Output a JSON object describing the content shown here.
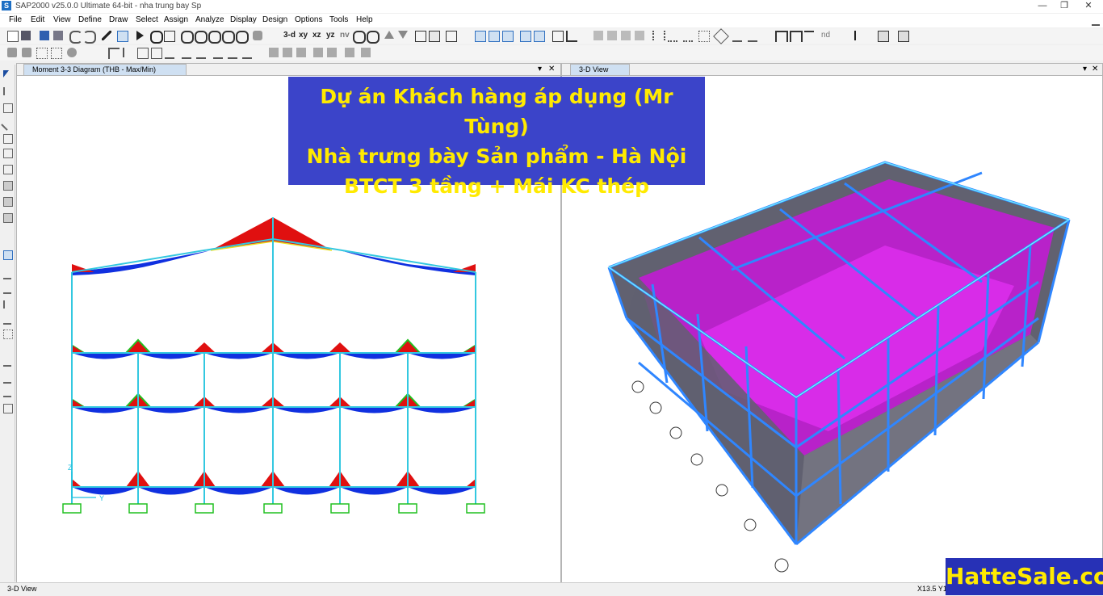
{
  "window": {
    "title": "SAP2000 v25.0.0 Ultimate 64-bit - nha trung bay Sp",
    "app_icon": "S",
    "minimize": "—",
    "restore": "❐",
    "close": "✕"
  },
  "menu": [
    "File",
    "Edit",
    "View",
    "Define",
    "Draw",
    "Select",
    "Assign",
    "Analyze",
    "Display",
    "Design",
    "Options",
    "Tools",
    "Help"
  ],
  "toolbar": {
    "view_buttons": [
      "3-d",
      "xy",
      "xz",
      "yz",
      "nv"
    ],
    "nd_label": "nd"
  },
  "left_pane": {
    "tab_label": "Moment 3-3 Diagram  (THB - Max/Min)",
    "axis_y_label": "Y",
    "axis_z_label": "Z"
  },
  "right_pane": {
    "tab_label": "3-D View"
  },
  "pane_controls": {
    "dropdown": "▾",
    "close": "✕"
  },
  "status": {
    "left": "3-D View",
    "coords": "X13.5  Y1"
  },
  "banner": {
    "line1": "Dự án Khách hàng áp dụng (Mr Tùng)",
    "line2": "Nhà trưng bày Sản phẩm - Hà Nội",
    "line3": "BTCT 3 tầng + Mái KC thép"
  },
  "watermark": "HatteSale.com",
  "colors": {
    "frame": "#33c8e0",
    "moment_negative": "#e01010",
    "moment_positive": "#1030e0",
    "support": "#20c020",
    "slab": "#d020e0",
    "banner_bg": "#3b44c9",
    "banner_text": "#ffea00"
  }
}
